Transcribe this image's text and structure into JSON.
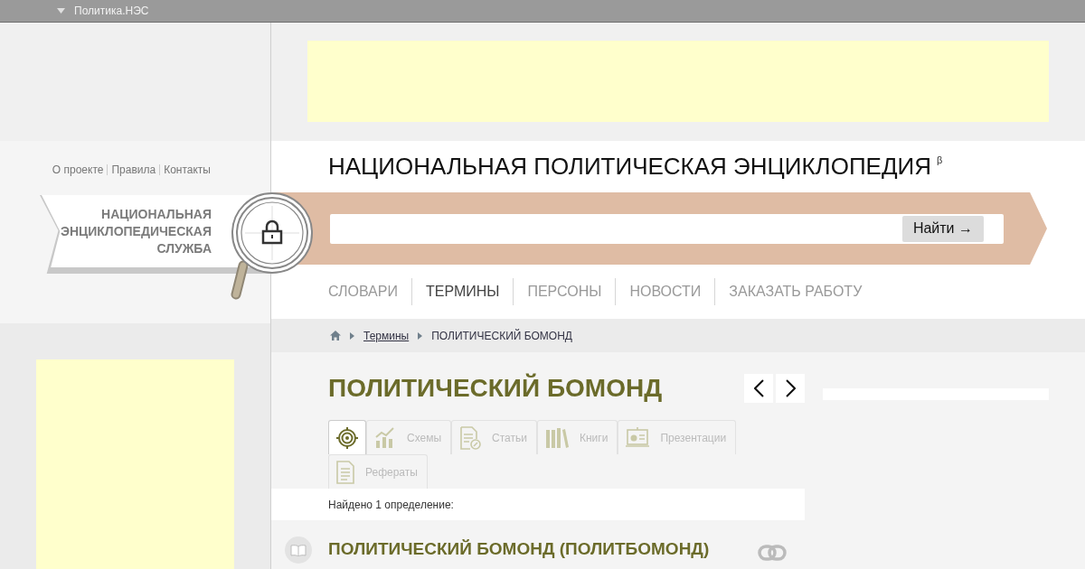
{
  "top_bar": {
    "menu": "Политика.НЭС"
  },
  "side_links": [
    "О проекте",
    "Правила",
    "Контакты"
  ],
  "service_logo": {
    "lines": [
      "НАЦИОНАЛЬНАЯ",
      "ЭНЦИКЛОПЕДИЧЕСКАЯ",
      "СЛУЖБА"
    ]
  },
  "site_title": {
    "text": "НАЦИОНАЛЬНАЯ ПОЛИТИЧЕСКАЯ ЭНЦИКЛОПЕДИЯ",
    "mark": "β"
  },
  "search": {
    "button": "Найти →"
  },
  "nav": [
    {
      "label": "СЛОВАРИ",
      "selected": false
    },
    {
      "label": "ТЕРМИНЫ",
      "selected": true
    },
    {
      "label": "ПЕРСОНЫ",
      "selected": false
    },
    {
      "label": "НОВОСТИ",
      "selected": false
    },
    {
      "label": "ЗАКАЗАТЬ РАБОТУ",
      "selected": false
    }
  ],
  "breadcrumb": {
    "link": "Термины",
    "current": "ПОЛИТИЧЕСКИЙ БОМОНД"
  },
  "page_title": "ПОЛИТИЧЕСКИЙ БОМОНД",
  "tabs": [
    {
      "kind": "definitions",
      "selected": true
    },
    {
      "kind": "schemes",
      "label": "Схемы",
      "selected": false
    },
    {
      "kind": "articles",
      "label": "Статьи",
      "selected": false
    },
    {
      "kind": "books",
      "label": "Книги",
      "selected": false
    },
    {
      "kind": "presentations",
      "label": "Презентации",
      "selected": false
    },
    {
      "kind": "essays",
      "label": "Рефераты",
      "selected": false
    }
  ],
  "found": "Найдено 1 определение:",
  "entries": [
    {
      "title": "ПОЛИТИЧЕСКИЙ БОМОНД (ПОЛИТБОМОНД)"
    }
  ]
}
